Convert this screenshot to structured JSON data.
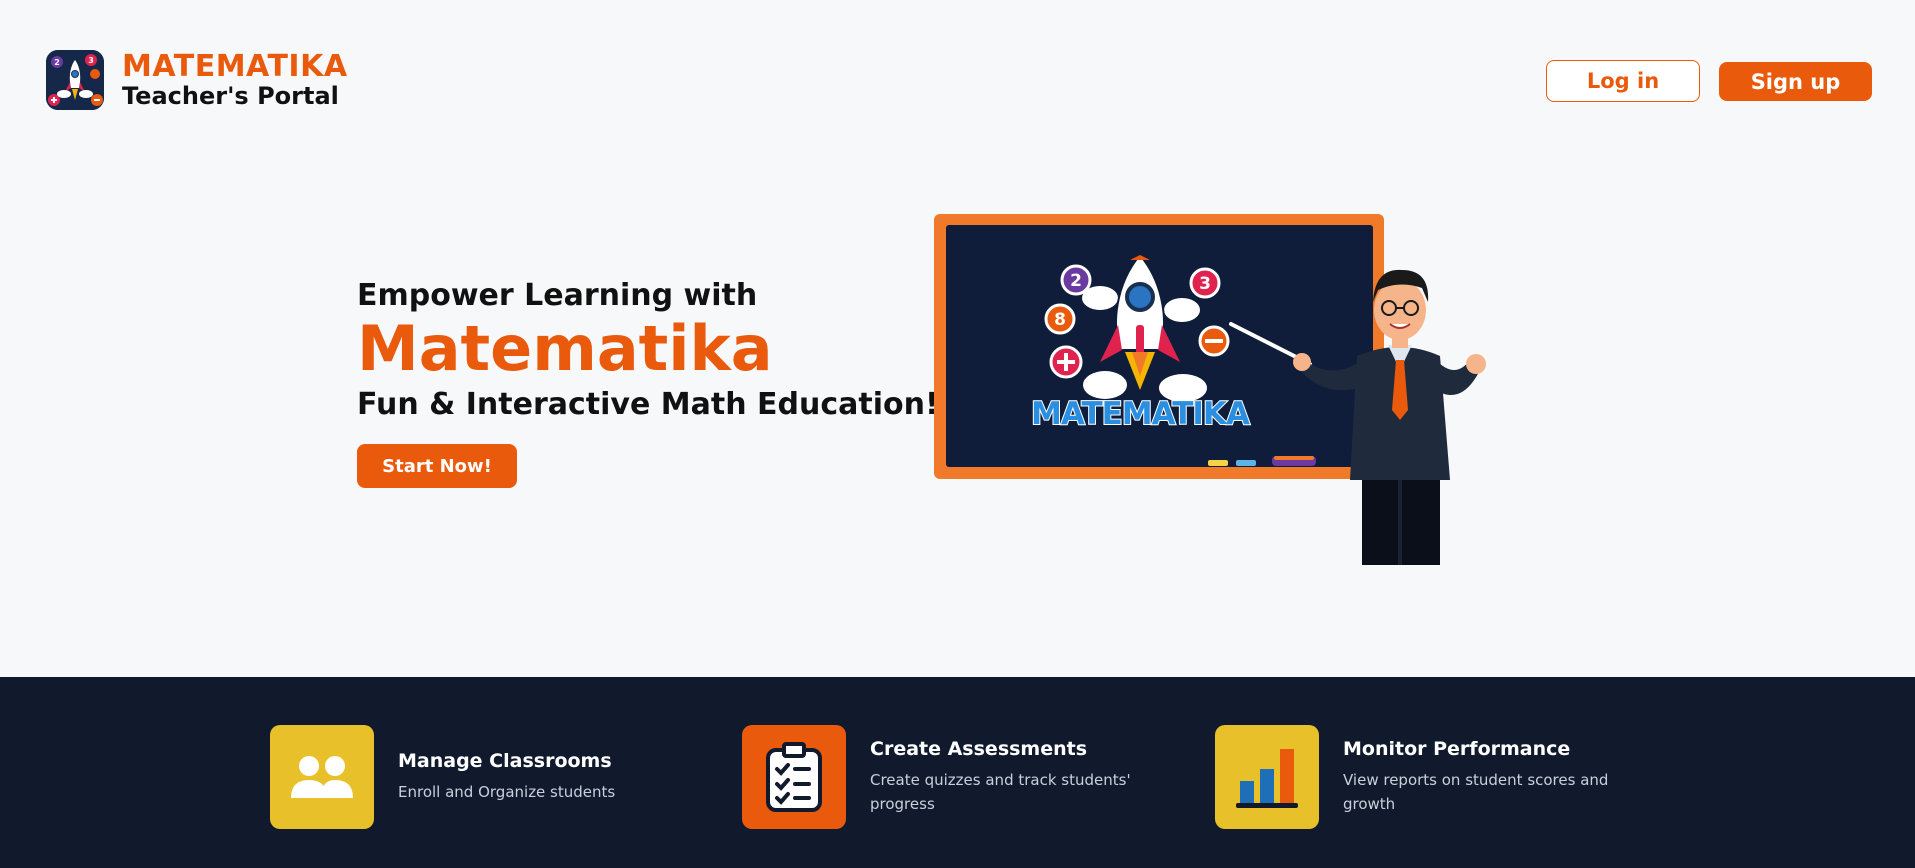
{
  "header": {
    "brand_title": "MATEMATIKA",
    "brand_subtitle": "Teacher's Portal",
    "login_label": "Log in",
    "signup_label": "Sign up"
  },
  "hero": {
    "line1": "Empower Learning with",
    "brand": "Matematika",
    "line3": "Fun & Interactive Math Education!",
    "cta_label": "Start Now!",
    "board_text": "MATEMATIKA",
    "bubbles": [
      "2",
      "3",
      "8",
      "+",
      "−"
    ]
  },
  "features": [
    {
      "title": "Manage Classrooms",
      "desc": "Enroll and Organize students",
      "icon": "users-icon",
      "color": "#e8c12a"
    },
    {
      "title": "Create Assessments",
      "desc": "Create quizzes and track students' progress",
      "icon": "clipboard-list-icon",
      "color": "#ea5a0c"
    },
    {
      "title": "Monitor Performance",
      "desc": "View reports on student scores and growth",
      "icon": "bar-chart-icon",
      "color": "#e8c12a"
    }
  ],
  "colors": {
    "accent": "#ea5a0c",
    "dark": "#111a2c",
    "yellow": "#e8c12a",
    "board": "#0f1d3a"
  }
}
